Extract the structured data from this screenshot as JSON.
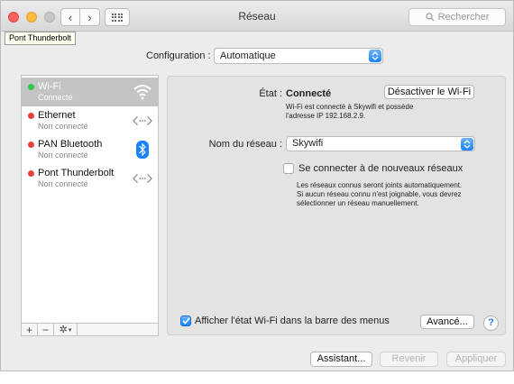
{
  "window": {
    "title": "Réseau"
  },
  "toolbar": {
    "search_placeholder": "Rechercher",
    "tooltip": "Pont Thunderbolt"
  },
  "config": {
    "label": "Configuration :",
    "value": "Automatique"
  },
  "services": [
    {
      "name": "Wi-Fi",
      "status": "Connecté",
      "dot_color": "#2ec845",
      "icon": "wifi-icon",
      "selected": true
    },
    {
      "name": "Ethernet",
      "status": "Non connecté",
      "dot_color": "#e8413c",
      "icon": "ethernet-icon",
      "selected": false
    },
    {
      "name": "PAN Bluetooth",
      "status": "Non connecté",
      "dot_color": "#e8413c",
      "icon": "bluetooth-icon",
      "selected": false
    },
    {
      "name": "Pont Thunderbolt",
      "status": "Non connecté",
      "dot_color": "#e8413c",
      "icon": "ethernet-icon",
      "selected": false
    }
  ],
  "sidebar_tools": {
    "add": "+",
    "remove": "−"
  },
  "detail": {
    "state_label": "État :",
    "state_value": "Connecté",
    "toggle_button": "Désactiver le Wi-Fi",
    "state_desc_line1": "Wi-Fi est connecté à Skywifi et possède",
    "state_desc_line2": "l'adresse IP 192.168.2.9.",
    "network_label": "Nom du réseau :",
    "network_value": "Skywifi",
    "join_new_label": "Se connecter à de nouveaux réseaux",
    "join_desc_line1": "Les réseaux connus seront joints automatiquement.",
    "join_desc_line2": "Si aucun réseau connu n'est joignable, vous devrez",
    "join_desc_line3": "sélectionner un réseau manuellement.",
    "show_status_label": "Afficher l'état Wi-Fi dans la barre des menus",
    "advanced_button": "Avancé...",
    "help_button": "?"
  },
  "footer": {
    "assistant": "Assistant...",
    "revert": "Revenir",
    "apply": "Appliquer"
  },
  "colors": {
    "accent": "#1a82fb",
    "connected": "#2ec845",
    "disconnected": "#e8413c"
  }
}
